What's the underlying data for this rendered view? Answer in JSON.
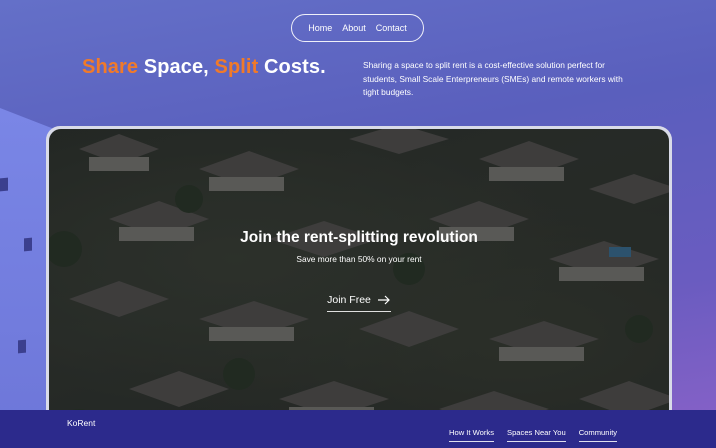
{
  "nav": {
    "items": [
      "Home",
      "About",
      "Contact"
    ]
  },
  "headline": {
    "part1": "Share",
    "part2": " Space, ",
    "part3": "Split",
    "part4": " Costs."
  },
  "intro": {
    "text": "Sharing a space to split rent is a cost-effective solution perfect for students, Small Scale Enterpreneurs (SMEs) and remote workers with tight budgets."
  },
  "hero": {
    "title": "Join the rent-splitting revolution",
    "subtitle": "Save more than 50% on your rent",
    "cta_label": "Join Free"
  },
  "footer": {
    "brand": "KoRent",
    "links": [
      "How It Works",
      "Spaces Near You",
      "Community"
    ]
  },
  "colors": {
    "accent": "#f07a2a",
    "background": "#5a5fbd",
    "footer": "#2c2a8c"
  },
  "icons": {
    "cta": "arrow-right-icon"
  }
}
